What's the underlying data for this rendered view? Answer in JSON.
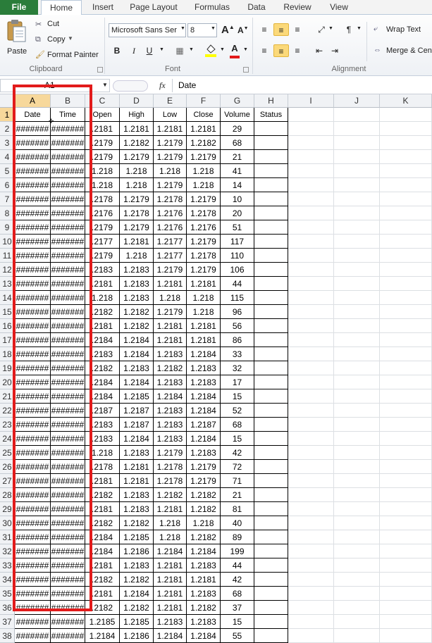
{
  "tabs": [
    "File",
    "Home",
    "Insert",
    "Page Layout",
    "Formulas",
    "Data",
    "Review",
    "View"
  ],
  "clipboard": {
    "paste": "Paste",
    "cut": "Cut",
    "copy": "Copy",
    "format_painter": "Format Painter",
    "group": "Clipboard"
  },
  "font": {
    "name": "Microsoft Sans Ser",
    "size": "8",
    "bold": "B",
    "italic": "I",
    "underline": "U",
    "fill_letter": "A",
    "group": "Font"
  },
  "alignment": {
    "wrap": "Wrap Text",
    "merge": "Merge & Cen",
    "group": "Alignment"
  },
  "formula_bar": {
    "name_box": "A1",
    "fx": "fx",
    "value": "Date"
  },
  "columns": [
    "A",
    "B",
    "C",
    "D",
    "E",
    "F",
    "G",
    "H",
    "I",
    "J",
    "K"
  ],
  "headers": [
    "Date",
    "Time",
    "Open",
    "High",
    "Low",
    "Close",
    "Volume",
    "Status"
  ],
  "hidden_value": "#######",
  "rows": [
    [
      "#######",
      "#######",
      ".2181",
      "1.2181",
      "1.2181",
      "1.2181",
      "29"
    ],
    [
      "#######",
      "#######",
      ".2179",
      "1.2182",
      "1.2179",
      "1.2182",
      "68"
    ],
    [
      "#######",
      "#######",
      ".2179",
      "1.2179",
      "1.2179",
      "1.2179",
      "21"
    ],
    [
      "#######",
      "#######",
      "1.218",
      "1.218",
      "1.218",
      "1.218",
      "41"
    ],
    [
      "#######",
      "#######",
      "1.218",
      "1.218",
      "1.2179",
      "1.218",
      "14"
    ],
    [
      "#######",
      "#######",
      ".2178",
      "1.2179",
      "1.2178",
      "1.2179",
      "10"
    ],
    [
      "#######",
      "#######",
      ".2176",
      "1.2178",
      "1.2176",
      "1.2178",
      "20"
    ],
    [
      "#######",
      "#######",
      ".2179",
      "1.2179",
      "1.2176",
      "1.2176",
      "51"
    ],
    [
      "#######",
      "#######",
      ".2177",
      "1.2181",
      "1.2177",
      "1.2179",
      "117"
    ],
    [
      "#######",
      "#######",
      ".2179",
      "1.218",
      "1.2177",
      "1.2178",
      "110"
    ],
    [
      "#######",
      "#######",
      ".2183",
      "1.2183",
      "1.2179",
      "1.2179",
      "106"
    ],
    [
      "#######",
      "#######",
      ".2181",
      "1.2183",
      "1.2181",
      "1.2181",
      "44"
    ],
    [
      "#######",
      "#######",
      "1.218",
      "1.2183",
      "1.218",
      "1.218",
      "115"
    ],
    [
      "#######",
      "#######",
      ".2182",
      "1.2182",
      "1.2179",
      "1.218",
      "96"
    ],
    [
      "#######",
      "#######",
      ".2181",
      "1.2182",
      "1.2181",
      "1.2181",
      "56"
    ],
    [
      "#######",
      "#######",
      ".2184",
      "1.2184",
      "1.2181",
      "1.2181",
      "86"
    ],
    [
      "#######",
      "#######",
      ".2183",
      "1.2184",
      "1.2183",
      "1.2184",
      "33"
    ],
    [
      "#######",
      "#######",
      ".2182",
      "1.2183",
      "1.2182",
      "1.2183",
      "32"
    ],
    [
      "#######",
      "#######",
      ".2184",
      "1.2184",
      "1.2183",
      "1.2183",
      "17"
    ],
    [
      "#######",
      "#######",
      ".2184",
      "1.2185",
      "1.2184",
      "1.2184",
      "15"
    ],
    [
      "#######",
      "#######",
      ".2187",
      "1.2187",
      "1.2183",
      "1.2184",
      "52"
    ],
    [
      "#######",
      "#######",
      ".2183",
      "1.2187",
      "1.2183",
      "1.2187",
      "68"
    ],
    [
      "#######",
      "#######",
      ".2183",
      "1.2184",
      "1.2183",
      "1.2184",
      "15"
    ],
    [
      "#######",
      "#######",
      "1.218",
      "1.2183",
      "1.2179",
      "1.2183",
      "42"
    ],
    [
      "#######",
      "#######",
      ".2178",
      "1.2181",
      "1.2178",
      "1.2179",
      "72"
    ],
    [
      "#######",
      "#######",
      ".2181",
      "1.2181",
      "1.2178",
      "1.2179",
      "71"
    ],
    [
      "#######",
      "#######",
      ".2182",
      "1.2183",
      "1.2182",
      "1.2182",
      "21"
    ],
    [
      "#######",
      "#######",
      ".2181",
      "1.2183",
      "1.2181",
      "1.2182",
      "81"
    ],
    [
      "#######",
      "#######",
      ".2182",
      "1.2182",
      "1.218",
      "1.218",
      "40"
    ],
    [
      "#######",
      "#######",
      ".2184",
      "1.2185",
      "1.218",
      "1.2182",
      "89"
    ],
    [
      "#######",
      "#######",
      ".2184",
      "1.2186",
      "1.2184",
      "1.2184",
      "199"
    ],
    [
      "#######",
      "#######",
      ".2181",
      "1.2183",
      "1.2181",
      "1.2183",
      "44"
    ],
    [
      "#######",
      "#######",
      ".2182",
      "1.2182",
      "1.2181",
      "1.2181",
      "42"
    ],
    [
      "#######",
      "#######",
      ".2181",
      "1.2184",
      "1.2181",
      "1.2183",
      "68"
    ],
    [
      "#######",
      "#######",
      ".2182",
      "1.2182",
      "1.2181",
      "1.2182",
      "37"
    ],
    [
      "#######",
      "#######",
      "1.2185",
      "1.2185",
      "1.2183",
      "1.2183",
      "15"
    ],
    [
      "#######",
      "#######",
      "1.2184",
      "1.2186",
      "1.2184",
      "1.2184",
      "55"
    ]
  ],
  "colors": {
    "file_tab": "#2a7d3a",
    "highlight_box": "#e21b1b",
    "selected_header": "#f7d89b"
  }
}
